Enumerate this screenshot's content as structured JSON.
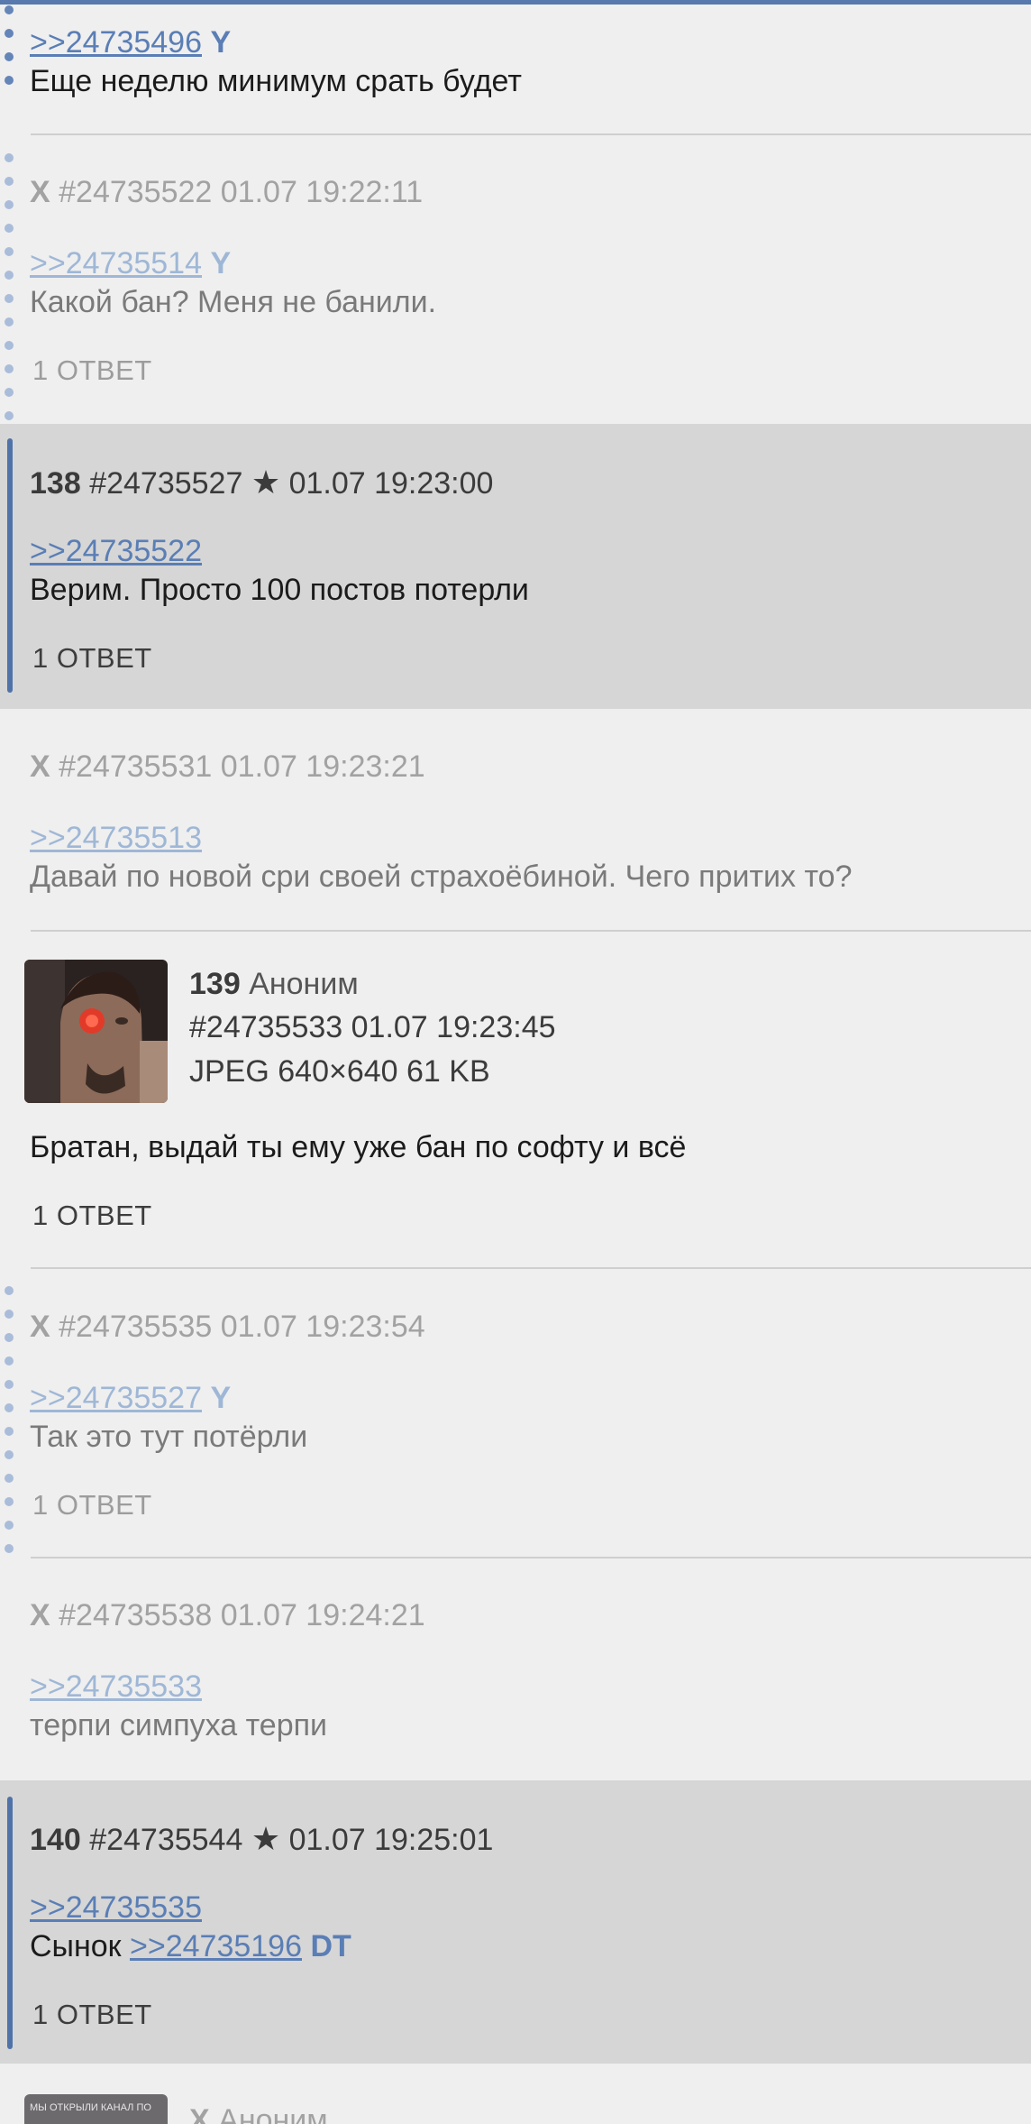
{
  "posts": [
    {
      "ref": ">>24735496",
      "tag": "Y",
      "text": "Еще неделю минимум срать будет"
    },
    {
      "name": "X",
      "meta": "#24735522 01.07 19:22:11",
      "ref": ">>24735514",
      "tag": "Y",
      "text": "Какой бан? Меня не банили.",
      "replies": "1 ОТВЕТ"
    },
    {
      "number": "138",
      "id": "#24735527",
      "star": "★",
      "date": "01.07 19:23:00",
      "ref": ">>24735522",
      "text": "Верим. Просто 100 постов потерли",
      "replies": "1 ОТВЕТ"
    },
    {
      "name": "X",
      "meta": "#24735531 01.07 19:23:21",
      "ref": ">>24735513",
      "text": "Давай по новой сри своей страхоёбиной. Чего притих то?"
    },
    {
      "number": "139",
      "author": "Аноним",
      "id_date": "#24735533 01.07 19:23:45",
      "file": "JPEG 640×640 61 KB",
      "text": "Братан, выдай ты ему уже бан по софту и всё",
      "replies": "1 ОТВЕТ"
    },
    {
      "name": "X",
      "meta": "#24735535 01.07 19:23:54",
      "ref": ">>24735527",
      "tag": "Y",
      "text": "Так это тут потёрли",
      "replies": "1 ОТВЕТ"
    },
    {
      "name": "X",
      "meta": "#24735538 01.07 19:24:21",
      "ref": ">>24735533",
      "text": "терпи симпуха терпи"
    },
    {
      "number": "140",
      "id": "#24735544",
      "star": "★",
      "date": "01.07 19:25:01",
      "ref": ">>24735535",
      "text_prefix": "Сынок",
      "inline_ref": ">>24735196",
      "inline_tag": "DT",
      "replies": "1 ОТВЕТ"
    },
    {
      "name": "X",
      "author": "Аноним",
      "thumb_text": "МЫ ОТКРЫЛИ КАНАЛ ПО"
    }
  ],
  "colors": {
    "link": "#5a7eb5",
    "highlight_bg": "#d6d6d6",
    "page_bg": "#efefef",
    "accent_bar": "#4f73a8"
  },
  "icons": {
    "star": "star-icon",
    "avatar": "avatar-thumbnail"
  }
}
